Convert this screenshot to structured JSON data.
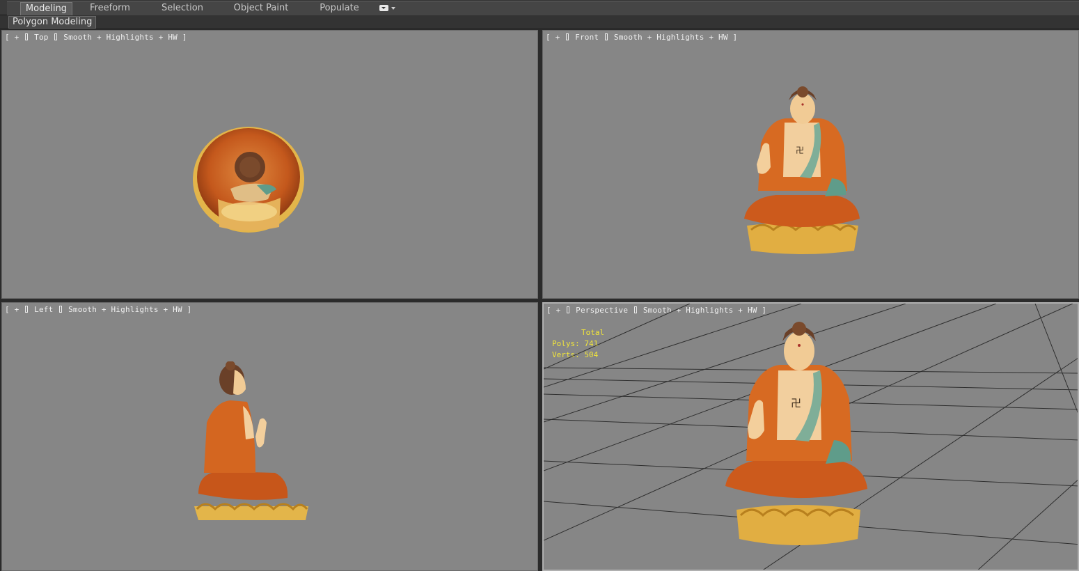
{
  "ribbon": {
    "tabs": [
      {
        "label": "Modeling",
        "active": true
      },
      {
        "label": "Freeform"
      },
      {
        "label": "Selection"
      },
      {
        "label": "Object Paint"
      },
      {
        "label": "Populate"
      }
    ],
    "menu_icon": "dropdown-toggle-icon",
    "panel_label": "Polygon Modeling"
  },
  "viewports": {
    "top": {
      "prefix": "[ + ",
      "name": "Top",
      "shading": "Smooth + Highlights + HW ]"
    },
    "front": {
      "prefix": "[ + ",
      "name": "Front",
      "shading": "Smooth + Highlights + HW ]"
    },
    "left": {
      "prefix": "[ + ",
      "name": "Left",
      "shading": "Smooth + Highlights + HW ]"
    },
    "perspective": {
      "prefix": "[ + ",
      "name": "Perspective",
      "shading": "Smooth + Highlights + HW ]"
    }
  },
  "stats": {
    "header": "Total",
    "polys_label": "Polys:",
    "polys_value": "741",
    "verts_label": "Verts:",
    "verts_value": "504"
  },
  "colors": {
    "viewport_bg": "#868686",
    "stats_text": "#f2e63a",
    "robe_orange": "#d2651e",
    "robe_green": "#5f9c8a",
    "skin": "#f0c897",
    "hair": "#6a4028",
    "lotus_gold": "#e3b54a"
  },
  "objects": {
    "model": "buddha-statue"
  }
}
